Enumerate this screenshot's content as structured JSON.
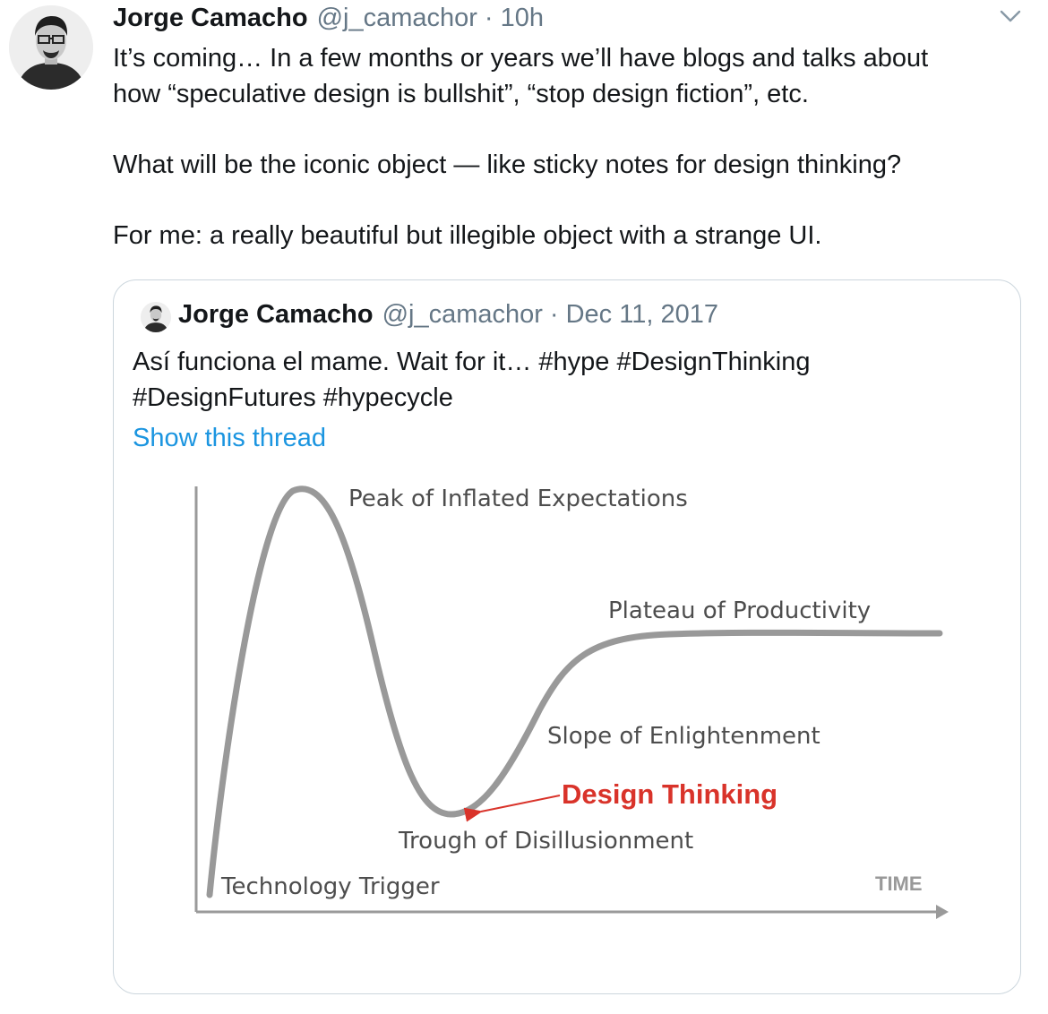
{
  "tweet": {
    "author": {
      "name": "Jorge Camacho",
      "handle": "@j_camachor"
    },
    "separator": "·",
    "time": "10h",
    "paragraphs": [
      "It’s coming… In a few months or years we’ll have blogs and talks about\nhow “speculative design is bullshit”, “stop design fiction”, etc.",
      "What will be the iconic object — like sticky notes for design thinking?",
      "For me: a really beautiful but illegible object with a strange UI."
    ],
    "menu_icon": "chevron-down-icon"
  },
  "quoted": {
    "author": {
      "name": "Jorge Camacho",
      "handle": "@j_camachor"
    },
    "separator": "·",
    "date": "Dec 11, 2017",
    "text_lines": [
      "Así funciona el mame. Wait for it… #hype #DesignThinking",
      "#DesignFutures #hypecycle"
    ],
    "thread_link": "Show this thread",
    "image": {
      "labels": {
        "peak": "Peak of Inflated Expectations",
        "plateau": "Plateau of Productivity",
        "slope": "Slope of Enlightenment",
        "highlight": "Design Thinking",
        "trough": "Trough of Disillusionment",
        "trigger": "Technology Trigger",
        "axis": "TIME"
      },
      "curve_color": "#999999",
      "highlight_color": "#d9332a"
    }
  },
  "colors": {
    "text": "#14171a",
    "secondary": "#657786",
    "link": "#1b95e0",
    "border": "#ccd6dd"
  }
}
